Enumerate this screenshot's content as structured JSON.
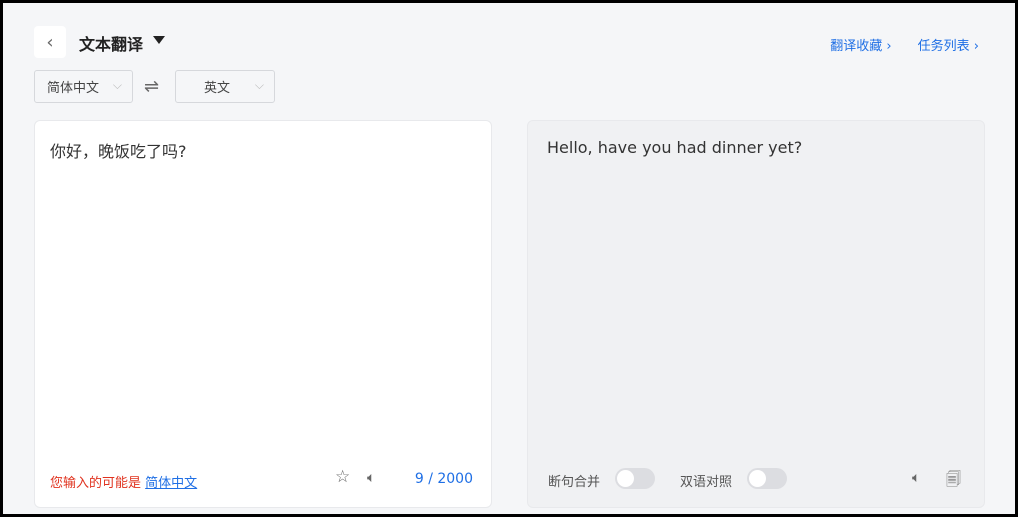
{
  "header": {
    "title": "文本翻译",
    "links": [
      "翻译收藏",
      "任务列表"
    ]
  },
  "languages": {
    "source": "简体中文",
    "target": "英文"
  },
  "source": {
    "text": "你好，晚饭吃了吗?",
    "detect_prefix": "您输入的可能是",
    "detect_lang": "简体中文",
    "count": "9 / 2000"
  },
  "result": {
    "text": "Hello, have you had dinner yet?",
    "toggles": [
      {
        "label": "断句合并",
        "on": false
      },
      {
        "label": "双语对照",
        "on": false
      }
    ]
  }
}
